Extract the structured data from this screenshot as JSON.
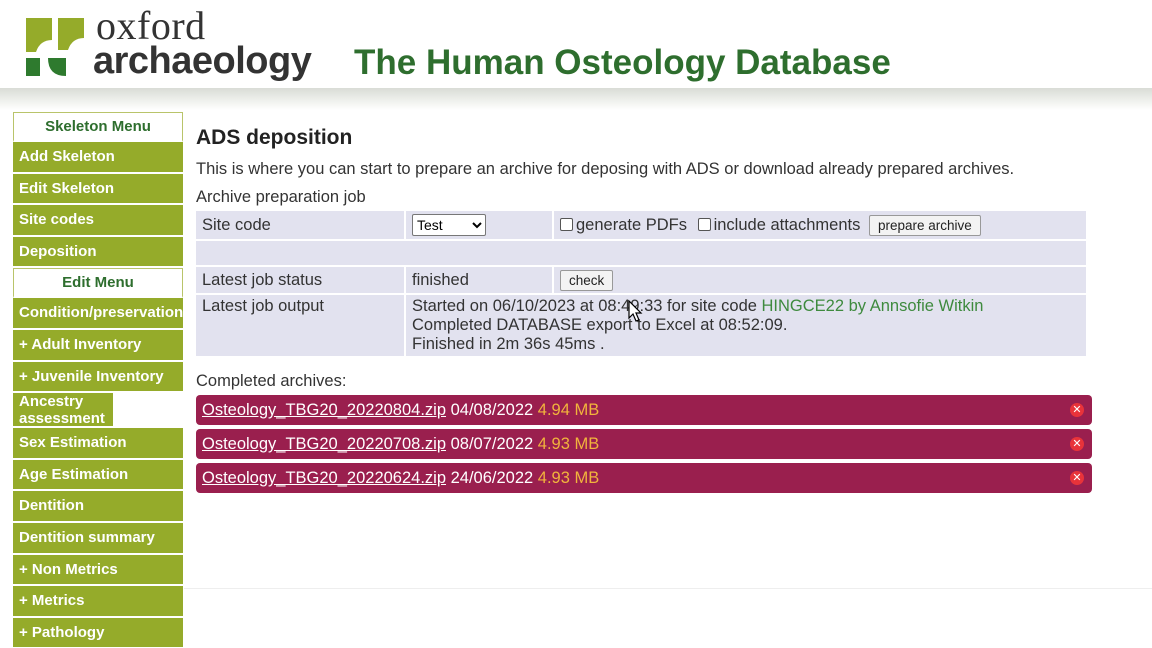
{
  "header": {
    "logo_line1": "oxford",
    "logo_line2": "archaeology",
    "site_title": "The Human Osteology Database"
  },
  "sidebar": {
    "skeleton_menu_title": "Skeleton Menu",
    "skeleton_items": [
      {
        "label": "Add Skeleton"
      },
      {
        "label": "Edit Skeleton"
      },
      {
        "label": "Site codes"
      },
      {
        "label": "Deposition"
      }
    ],
    "edit_menu_title": "Edit Menu",
    "edit_items": [
      {
        "label": "Condition/preservation"
      },
      {
        "label": "+ Adult Inventory"
      },
      {
        "label": "+ Juvenile Inventory"
      },
      {
        "label": "Ancestry assessment"
      },
      {
        "label": "Sex Estimation"
      },
      {
        "label": "Age Estimation"
      },
      {
        "label": "Dentition"
      },
      {
        "label": "Dentition summary"
      },
      {
        "label": "+ Non Metrics"
      },
      {
        "label": "+ Metrics"
      },
      {
        "label": "+ Pathology"
      }
    ]
  },
  "main": {
    "heading": "ADS deposition",
    "intro": "This is where you can start to prepare an archive for deposing with ADS or download already prepared archives.",
    "job_label": "Archive preparation job",
    "site_code_label": "Site code",
    "site_code_value": "Test",
    "generate_pdfs_label": "generate PDFs",
    "include_attachments_label": "include attachments",
    "prepare_button": "prepare archive",
    "status_label": "Latest job status",
    "status_value": "finished",
    "check_button": "check",
    "output_label": "Latest job output",
    "output_line1_prefix": "Started on 06/10/2023 at 08:49:33 for site code ",
    "output_line1_site": "HINGCE22 by Annsofie Witkin",
    "output_line2": "Completed DATABASE export to Excel at 08:52:09.",
    "output_line3": "Finished in 2m 36s 45ms .",
    "completed_label": "Completed archives:",
    "archives": [
      {
        "name": "Osteology_TBG20_20220804.zip",
        "date": "04/08/2022",
        "size": "4.94 MB"
      },
      {
        "name": "Osteology_TBG20_20220708.zip",
        "date": "08/07/2022",
        "size": "4.93 MB"
      },
      {
        "name": "Osteology_TBG20_20220624.zip",
        "date": "24/06/2022",
        "size": "4.93 MB"
      }
    ]
  },
  "colors": {
    "brand_green": "#95ab2a",
    "title_green": "#2e6e2e",
    "archive_bg": "#9a1f4e",
    "archive_size": "#f1b43c",
    "table_cell": "#e2e2ef"
  }
}
